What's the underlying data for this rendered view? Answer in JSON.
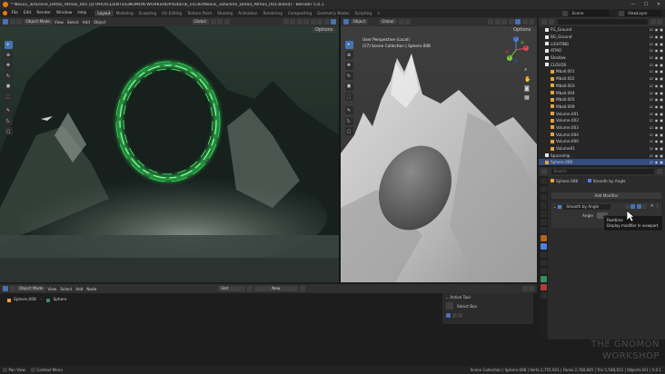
{
  "window": {
    "title": "* Nexus_3DScene_Detail_Atmos_001 [D:\\PRO\\CLIENTS\\GNOMON WORKSHOP\\tutorial_01\\3D\\Nexus_3DScene_Detail_Atmos_001.blend] - Blender 5.0.1",
    "min": "—",
    "max": "☐",
    "close": "✕"
  },
  "menubar": {
    "items": [
      "File",
      "Edit",
      "Render",
      "Window",
      "Help"
    ],
    "workspaces": [
      "Layout",
      "Modeling",
      "Sculpting",
      "UV Editing",
      "Texture Paint",
      "Shading",
      "Animation",
      "Rendering",
      "Compositing",
      "Geometry Nodes",
      "Scripting",
      "+"
    ],
    "active_workspace": "Layout",
    "scene": "Scene",
    "view_layer": "ViewLayer"
  },
  "viewport_left": {
    "mode": "Object Mode",
    "menus": [
      "View",
      "Select",
      "Add",
      "Object"
    ],
    "transform": "Global",
    "options": "Options"
  },
  "viewport_right": {
    "mode": "Object",
    "transform": "Global",
    "options": "Options",
    "overlay_line1": "User Perspective (Local)",
    "overlay_line2": "(17) Scene Collection | Sphere.008",
    "gizmo": {
      "x": "X",
      "y": "Y",
      "z": "Z"
    }
  },
  "outliner": {
    "items": [
      {
        "name": "FG_Ground",
        "color": "#e8e8e8",
        "selected": false
      },
      {
        "name": "BG_Ground",
        "color": "#e8e8e8",
        "selected": false
      },
      {
        "name": "LIGHTING",
        "color": "#e8e8e8",
        "selected": false
      },
      {
        "name": "ATMO",
        "color": "#e8e8e8",
        "selected": false
      },
      {
        "name": "Shadow",
        "color": "#e8e8e8",
        "selected": false
      },
      {
        "name": "CLOUDS",
        "color": "#e8e8e8",
        "selected": false
      },
      {
        "name": "Mball.001",
        "color": "#e3a33c",
        "selected": false
      },
      {
        "name": "Mball.002",
        "color": "#e3a33c",
        "selected": false
      },
      {
        "name": "Mball.003",
        "color": "#e3a33c",
        "selected": false
      },
      {
        "name": "Mball.004",
        "color": "#e3a33c",
        "selected": false
      },
      {
        "name": "Mball.005",
        "color": "#e3a33c",
        "selected": false
      },
      {
        "name": "Mball.009",
        "color": "#e3a33c",
        "selected": false
      },
      {
        "name": "Volume.001",
        "color": "#e3a33c",
        "selected": false
      },
      {
        "name": "Volume.002",
        "color": "#e3a33c",
        "selected": false
      },
      {
        "name": "Volume.003",
        "color": "#e3a33c",
        "selected": false
      },
      {
        "name": "Volume.004",
        "color": "#e3a33c",
        "selected": false
      },
      {
        "name": "Volume.000",
        "color": "#e3a33c",
        "selected": false
      },
      {
        "name": "Volume01",
        "color": "#e3a33c",
        "selected": false
      },
      {
        "name": "Spaceship",
        "color": "#e8e8e8",
        "selected": false
      },
      {
        "name": "Sphere.008",
        "color": "#e3a33c",
        "selected": true
      }
    ]
  },
  "properties": {
    "object_name": "Sphere.008",
    "modifier_tab": "Smooth by Angle",
    "add_modifier": "Add Modifier",
    "modifier_name": "Smooth by Angle",
    "angle_label": "Angle",
    "tooltip_title": "Realtime",
    "tooltip_desc": "Display modifier in viewport.",
    "search_placeholder": "Search"
  },
  "bottom_editor": {
    "mode": "Object Mode",
    "menus": [
      "View",
      "Select",
      "Add",
      "Node"
    ],
    "slot": "Slot",
    "new_label": "New",
    "breadcrumb_obj": "Sphere.008",
    "breadcrumb_mesh": "Sphere",
    "active_tool_title": "Active Tool",
    "select_box": "Select Box"
  },
  "watermark": {
    "line1": "THE GNOMON",
    "line2": "WORKSHOP"
  },
  "statusbar": {
    "left1": "Pan View",
    "left2": "Context Menu",
    "right": "Scene Collection | Sphere.008 | Verts 2,755,921 | Faces 2,780,845 | Tris 5,548,011 | Objects 0/1 | 5.0.1"
  },
  "colors": {
    "accent": "#4772b3",
    "selection": "#334d80",
    "portal_glow": "#39ff63",
    "object_orange": "#e3a33c"
  }
}
